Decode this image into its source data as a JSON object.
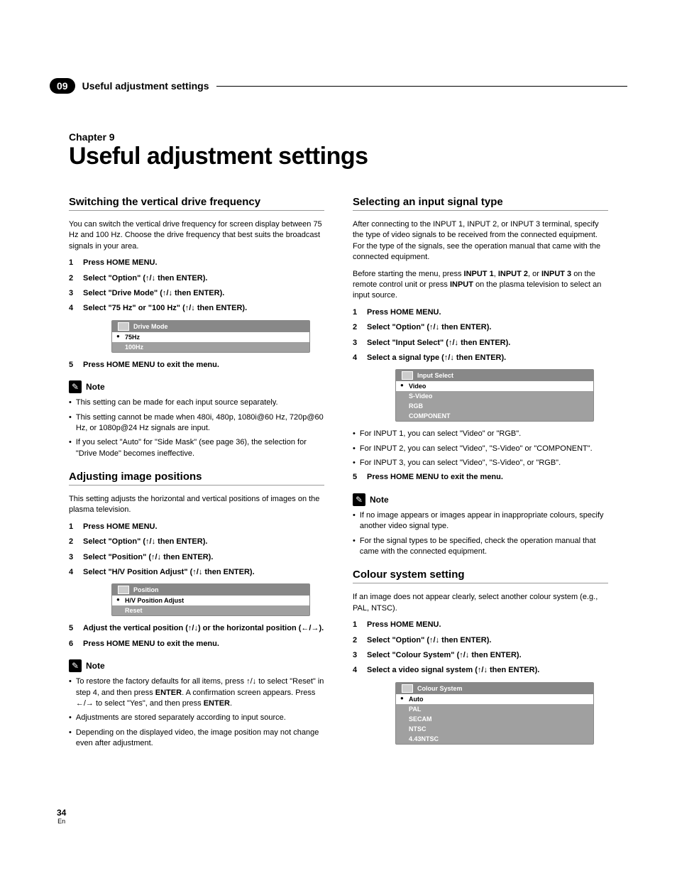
{
  "header": {
    "chapter_num": "09",
    "chapter_title_header": "Useful adjustment settings"
  },
  "chapter": {
    "label": "Chapter 9",
    "title": "Useful adjustment settings"
  },
  "arrows_ud": "↑/↓",
  "arrows_lr": "←/→",
  "sec1": {
    "heading": "Switching the vertical drive frequency",
    "intro": "You can switch the vertical drive frequency for screen display between 75 Hz and 100 Hz. Choose the drive frequency that best suits the broadcast signals in your area.",
    "steps": [
      "Press HOME MENU.",
      "Select \"Option\" (↑/↓ then ENTER).",
      "Select \"Drive Mode\" (↑/↓ then ENTER).",
      "Select \"75 Hz\" or \"100 Hz\" (↑/↓ then ENTER)."
    ],
    "menu": {
      "title": "Drive Mode",
      "items": [
        "75Hz",
        "100Hz"
      ],
      "selected": 0
    },
    "step5": "Press HOME MENU to exit the menu.",
    "notes": [
      "This setting can be made for each input source separately.",
      "This setting cannot be made when 480i, 480p, 1080i@60 Hz, 720p@60 Hz, or 1080p@24 Hz signals are input.",
      "If you select \"Auto\" for \"Side Mask\" (see page 36), the selection for \"Drive Mode\" becomes ineffective."
    ]
  },
  "sec2": {
    "heading": "Adjusting image positions",
    "intro": "This setting adjusts the horizontal and vertical positions of images on the plasma television.",
    "steps": [
      "Press HOME MENU.",
      "Select \"Option\" (↑/↓ then ENTER).",
      "Select \"Position\" (↑/↓ then ENTER).",
      "Select \"H/V Position Adjust\" (↑/↓ then ENTER)."
    ],
    "menu": {
      "title": "Position",
      "items": [
        "H/V Position Adjust",
        "Reset"
      ],
      "selected": 0
    },
    "step5": "Adjust the vertical position (↑/↓) or the horizontal position (←/→).",
    "step6": "Press HOME MENU to exit the menu.",
    "notes_pre": "To restore the factory defaults for all items, press ↑/↓ to select \"Reset\" in step 4, and then press ",
    "notes_mid": ". A confirmation screen appears. Press ←/→ to select \"Yes\", and then press ",
    "enter": "ENTER",
    "notes2": "Adjustments are stored separately according to input source.",
    "notes3": "Depending on the displayed video, the image position may not change even after adjustment."
  },
  "sec3": {
    "heading": "Selecting an input signal type",
    "intro1": "After connecting to the INPUT 1, INPUT 2, or INPUT 3 terminal, specify the type of video signals to be received from the connected equipment. For the type of the signals, see the operation manual that came with the connected equipment.",
    "intro2_pre": "Before starting the menu, press ",
    "intro2_b1": "INPUT 1",
    "intro2_mid1": ", ",
    "intro2_b2": "INPUT 2",
    "intro2_mid2": ", or ",
    "intro2_b3": "INPUT 3",
    "intro2_post1": " on the remote control unit or press ",
    "intro2_b4": "INPUT",
    "intro2_post2": " on the plasma television to select an input source.",
    "steps": [
      "Press HOME MENU.",
      "Select \"Option\" (↑/↓ then ENTER).",
      "Select \"Input Select\" (↑/↓ then ENTER).",
      "Select a signal type (↑/↓ then ENTER)."
    ],
    "menu": {
      "title": "Input Select",
      "items": [
        "Video",
        "S-Video",
        "RGB",
        "COMPONENT"
      ],
      "selected": 0
    },
    "bullets": [
      "For INPUT 1, you can select \"Video\" or \"RGB\".",
      "For INPUT 2, you can select \"Video\", \"S-Video\" or \"COMPONENT\".",
      "For INPUT 3, you can select \"Video\", \"S-Video\", or \"RGB\"."
    ],
    "step5": "Press HOME MENU to exit the menu.",
    "notes": [
      "If no image appears or images appear in inappropriate colours, specify another video signal type.",
      "For the signal types to be specified, check the operation manual that came with the connected equipment."
    ]
  },
  "sec4": {
    "heading": "Colour system setting",
    "intro": "If an image does not appear clearly, select another colour system (e.g., PAL, NTSC).",
    "steps": [
      "Press HOME MENU.",
      "Select \"Option\" (↑/↓ then ENTER).",
      "Select \"Colour System\" (↑/↓ then ENTER).",
      "Select a video signal system (↑/↓ then ENTER)."
    ],
    "menu": {
      "title": "Colour System",
      "items": [
        "Auto",
        "PAL",
        "SECAM",
        "NTSC",
        "4.43NTSC"
      ],
      "selected": 0
    }
  },
  "note_label": "Note",
  "footer": {
    "page": "34",
    "lang": "En"
  }
}
